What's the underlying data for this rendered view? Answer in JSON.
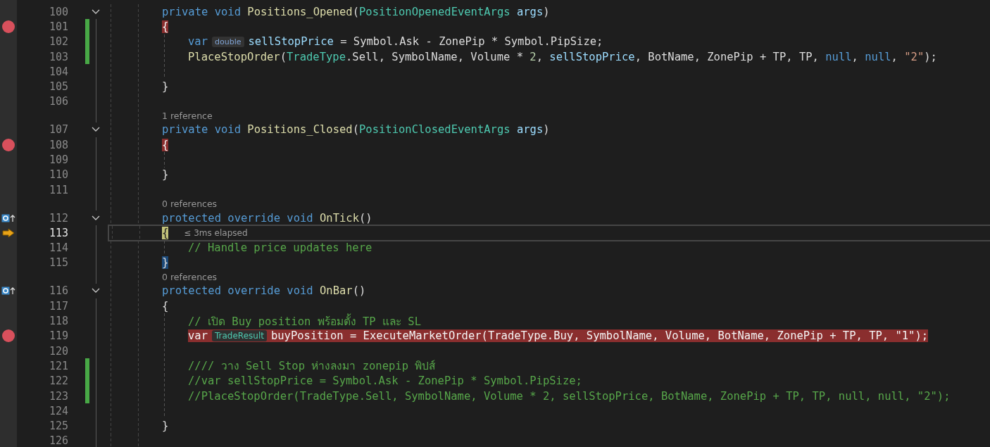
{
  "lines": [
    {
      "kind": "code",
      "number": "100",
      "expanded": true,
      "breakpoint": false,
      "overrides": false,
      "changed": false,
      "current": false,
      "indented": false,
      "segments": [
        {
          "kind": "code",
          "tokens": [
            {
              "kind": "keyword",
              "text": "private void "
            },
            {
              "kind": "method",
              "text": "Positions_Opened"
            },
            {
              "kind": "plain",
              "text": "("
            },
            {
              "kind": "type",
              "text": "PositionOpenedEventArgs "
            },
            {
              "kind": "variable",
              "text": "args"
            },
            {
              "kind": "plain",
              "text": ")"
            }
          ]
        }
      ]
    },
    {
      "kind": "code",
      "number": "101",
      "breakpoint": true,
      "overrides": false,
      "changed": true,
      "current": false,
      "indented": false,
      "segments": [
        {
          "kind": "brace",
          "text": "{",
          "matched": false
        }
      ]
    },
    {
      "kind": "code",
      "number": "102",
      "breakpoint": false,
      "overrides": false,
      "changed": true,
      "current": false,
      "indented": true,
      "segments": [
        {
          "kind": "code",
          "tokens": [
            {
              "kind": "keyword",
              "text": "var"
            }
          ]
        },
        {
          "kind": "hint",
          "text": "double",
          "color": "#7fa3d4"
        },
        {
          "kind": "code",
          "tokens": [
            {
              "kind": "variable",
              "text": "sellStopPrice"
            },
            {
              "kind": "plain",
              "text": " = Symbol.Ask - ZonePip * Symbol.PipSize;"
            }
          ]
        }
      ]
    },
    {
      "kind": "code",
      "number": "103",
      "breakpoint": false,
      "overrides": false,
      "changed": true,
      "current": false,
      "indented": true,
      "segments": [
        {
          "kind": "code",
          "tokens": [
            {
              "kind": "method",
              "text": "PlaceStopOrder"
            },
            {
              "kind": "plain",
              "text": "("
            },
            {
              "kind": "type",
              "text": "TradeType"
            },
            {
              "kind": "plain",
              "text": ".Sell, SymbolName, Volume * "
            },
            {
              "kind": "number",
              "text": "2"
            },
            {
              "kind": "plain",
              "text": ", "
            },
            {
              "kind": "variable",
              "text": "sellStopPrice"
            },
            {
              "kind": "plain",
              "text": ", BotName, ZonePip + TP, TP, "
            },
            {
              "kind": "keyword",
              "text": "null"
            },
            {
              "kind": "plain",
              "text": ", "
            },
            {
              "kind": "keyword",
              "text": "null"
            },
            {
              "kind": "plain",
              "text": ", "
            },
            {
              "kind": "string",
              "text": "\"2\""
            },
            {
              "kind": "plain",
              "text": ");"
            }
          ]
        }
      ]
    },
    {
      "kind": "code",
      "number": "104",
      "breakpoint": false,
      "overrides": false,
      "changed": false,
      "current": false,
      "indented": true
    },
    {
      "kind": "code",
      "number": "105",
      "breakpoint": false,
      "overrides": false,
      "changed": false,
      "current": false,
      "indented": false,
      "segments": [
        {
          "kind": "code",
          "tokens": [
            {
              "kind": "plain",
              "text": "}"
            }
          ]
        }
      ]
    },
    {
      "kind": "code",
      "number": "106",
      "breakpoint": false,
      "overrides": false,
      "changed": false,
      "current": false,
      "indented": false
    },
    {
      "kind": "lens",
      "text": "1 reference"
    },
    {
      "kind": "code",
      "number": "107",
      "expanded": true,
      "breakpoint": false,
      "overrides": false,
      "changed": false,
      "current": false,
      "indented": false,
      "segments": [
        {
          "kind": "code",
          "tokens": [
            {
              "kind": "keyword",
              "text": "private void "
            },
            {
              "kind": "method",
              "text": "Positions_Closed"
            },
            {
              "kind": "plain",
              "text": "("
            },
            {
              "kind": "type",
              "text": "PositionClosedEventArgs "
            },
            {
              "kind": "variable",
              "text": "args"
            },
            {
              "kind": "plain",
              "text": ")"
            }
          ]
        }
      ]
    },
    {
      "kind": "code",
      "number": "108",
      "breakpoint": true,
      "overrides": false,
      "changed": false,
      "current": false,
      "indented": false,
      "segments": [
        {
          "kind": "brace",
          "text": "{",
          "matched": false
        }
      ]
    },
    {
      "kind": "code",
      "number": "109",
      "breakpoint": false,
      "overrides": false,
      "changed": false,
      "current": false,
      "indented": true
    },
    {
      "kind": "code",
      "number": "110",
      "breakpoint": false,
      "overrides": false,
      "changed": false,
      "current": false,
      "indented": false,
      "segments": [
        {
          "kind": "code",
          "tokens": [
            {
              "kind": "plain",
              "text": "}"
            }
          ]
        }
      ]
    },
    {
      "kind": "code",
      "number": "111",
      "breakpoint": false,
      "overrides": false,
      "changed": false,
      "current": false,
      "indented": false
    },
    {
      "kind": "lens",
      "text": "0 references"
    },
    {
      "kind": "code",
      "number": "112",
      "expanded": true,
      "breakpoint": false,
      "overrides": true,
      "changed": false,
      "current": false,
      "indented": false,
      "segments": [
        {
          "kind": "code",
          "tokens": [
            {
              "kind": "keyword",
              "text": "protected override void "
            },
            {
              "kind": "method",
              "text": "OnTick"
            },
            {
              "kind": "plain",
              "text": "()"
            }
          ]
        }
      ]
    },
    {
      "kind": "code",
      "number": "113",
      "breakpoint": false,
      "overrides": false,
      "changed": false,
      "current": true,
      "indented": false,
      "segments": [
        {
          "kind": "brace",
          "text": "{",
          "matched": false
        },
        {
          "kind": "perf",
          "text": "≤ 3ms elapsed"
        }
      ]
    },
    {
      "kind": "code",
      "number": "114",
      "breakpoint": false,
      "overrides": false,
      "changed": false,
      "current": false,
      "indented": true,
      "segments": [
        {
          "kind": "code",
          "tokens": [
            {
              "kind": "comment",
              "text": "// Handle price updates here"
            }
          ]
        }
      ]
    },
    {
      "kind": "code",
      "number": "115",
      "breakpoint": false,
      "overrides": false,
      "changed": false,
      "current": false,
      "indented": false,
      "segments": [
        {
          "kind": "brace",
          "text": "}",
          "matched": true
        }
      ]
    },
    {
      "kind": "lens",
      "text": "0 references"
    },
    {
      "kind": "code",
      "number": "116",
      "expanded": true,
      "breakpoint": false,
      "overrides": true,
      "changed": false,
      "current": false,
      "indented": false,
      "segments": [
        {
          "kind": "code",
          "tokens": [
            {
              "kind": "keyword",
              "text": "protected override void "
            },
            {
              "kind": "method",
              "text": "OnBar"
            },
            {
              "kind": "plain",
              "text": "()"
            }
          ]
        }
      ]
    },
    {
      "kind": "code",
      "number": "117",
      "breakpoint": false,
      "overrides": false,
      "changed": false,
      "current": false,
      "indented": false,
      "segments": [
        {
          "kind": "code",
          "tokens": [
            {
              "kind": "plain",
              "text": "{"
            }
          ]
        }
      ]
    },
    {
      "kind": "code",
      "number": "118",
      "breakpoint": false,
      "overrides": false,
      "changed": false,
      "current": false,
      "indented": true,
      "segments": [
        {
          "kind": "code",
          "tokens": [
            {
              "kind": "comment",
              "text": "// เปิด Buy position พร้อมตั้ง TP และ SL"
            }
          ]
        }
      ]
    },
    {
      "kind": "code",
      "number": "119",
      "breakpoint": true,
      "overrides": false,
      "changed": false,
      "current": false,
      "indented": true,
      "segments": [
        {
          "kind": "code",
          "tokens": [
            {
              "kind": "keyword",
              "text": "var"
            }
          ]
        },
        {
          "kind": "hint",
          "text": "TradeResult",
          "color": "#4ec9b0"
        },
        {
          "kind": "code",
          "tokens": [
            {
              "kind": "plain",
              "text": "buyPosition = ExecuteMarketOrder(TradeType.Buy, SymbolName, Volume, BotName, ZonePip + TP, TP, \"1\");"
            }
          ]
        }
      ]
    },
    {
      "kind": "code",
      "number": "120",
      "breakpoint": false,
      "overrides": false,
      "changed": false,
      "current": false,
      "indented": true
    },
    {
      "kind": "code",
      "number": "121",
      "breakpoint": false,
      "overrides": false,
      "changed": true,
      "current": false,
      "indented": true,
      "segments": [
        {
          "kind": "code",
          "tokens": [
            {
              "kind": "comment",
              "text": "//// วาง Sell Stop ห่างลงมา zonepip พิปส์"
            }
          ]
        }
      ]
    },
    {
      "kind": "code",
      "number": "122",
      "breakpoint": false,
      "overrides": false,
      "changed": true,
      "current": false,
      "indented": true,
      "segments": [
        {
          "kind": "code",
          "tokens": [
            {
              "kind": "comment",
              "text": "//var sellStopPrice = Symbol.Ask - ZonePip * Symbol.PipSize;"
            }
          ]
        }
      ]
    },
    {
      "kind": "code",
      "number": "123",
      "breakpoint": false,
      "overrides": false,
      "changed": true,
      "current": false,
      "indented": true,
      "segments": [
        {
          "kind": "code",
          "tokens": [
            {
              "kind": "comment",
              "text": "//PlaceStopOrder(TradeType.Sell, SymbolName, Volume * 2, sellStopPrice, BotName, ZonePip + TP, TP, null, null, \"2\");"
            }
          ]
        }
      ]
    },
    {
      "kind": "code",
      "number": "124",
      "breakpoint": false,
      "overrides": false,
      "changed": false,
      "current": false,
      "indented": true
    },
    {
      "kind": "code",
      "number": "125",
      "breakpoint": false,
      "overrides": false,
      "changed": false,
      "current": false,
      "indented": false,
      "segments": [
        {
          "kind": "code",
          "tokens": [
            {
              "kind": "plain",
              "text": "}"
            }
          ]
        }
      ]
    },
    {
      "kind": "code",
      "number": "126",
      "breakpoint": false,
      "overrides": false,
      "changed": false,
      "current": false,
      "indented": false
    }
  ]
}
